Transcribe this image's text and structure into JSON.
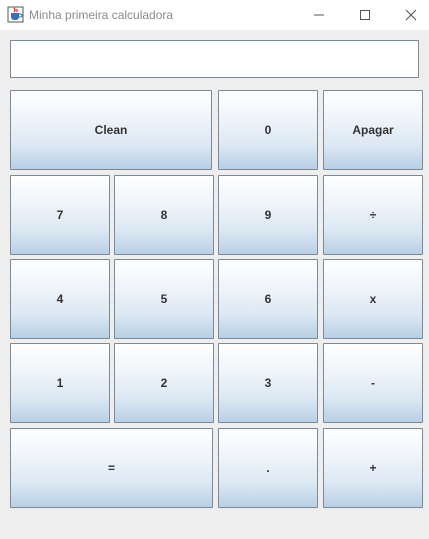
{
  "window": {
    "title": "Minha primeira calculadora",
    "icons": {
      "app": "java-cup-icon",
      "minimize": "minimize-icon",
      "maximize": "maximize-icon",
      "close": "close-icon"
    }
  },
  "display": {
    "value": ""
  },
  "keys": {
    "clean": "Clean",
    "zero": "0",
    "apagar": "Apagar",
    "seven": "7",
    "eight": "8",
    "nine": "9",
    "divide": "÷",
    "four": "4",
    "five": "5",
    "six": "6",
    "multiply": "x",
    "one": "1",
    "two": "2",
    "three": "3",
    "minus": "-",
    "equals": "=",
    "dot": ".",
    "plus": "+"
  }
}
